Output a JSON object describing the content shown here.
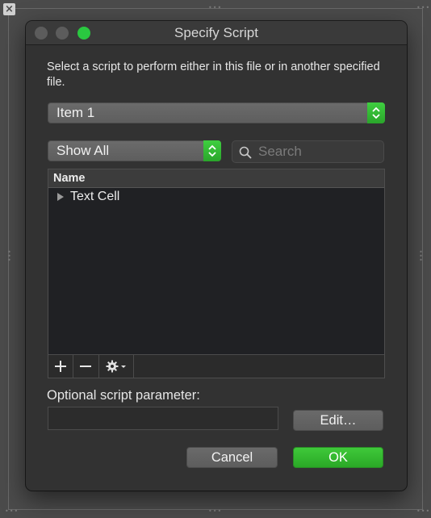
{
  "dialog": {
    "title": "Specify Script",
    "description": "Select a script to perform either in this file or in another specified file."
  },
  "file_popup": {
    "value": "Item 1"
  },
  "filter_popup": {
    "value": "Show All"
  },
  "search": {
    "placeholder": "Search",
    "value": ""
  },
  "list": {
    "header": "Name",
    "items": [
      {
        "label": "Text Cell",
        "expanded": false
      }
    ]
  },
  "toolbar": {
    "add_icon": "plus-icon",
    "remove_icon": "minus-icon",
    "actions_icon": "gear-icon"
  },
  "parameter": {
    "label": "Optional script parameter:",
    "value": ""
  },
  "buttons": {
    "edit": "Edit…",
    "cancel": "Cancel",
    "ok": "OK"
  },
  "colors": {
    "accent": "#2ac840",
    "window_bg": "#323232",
    "list_bg": "#202124"
  }
}
